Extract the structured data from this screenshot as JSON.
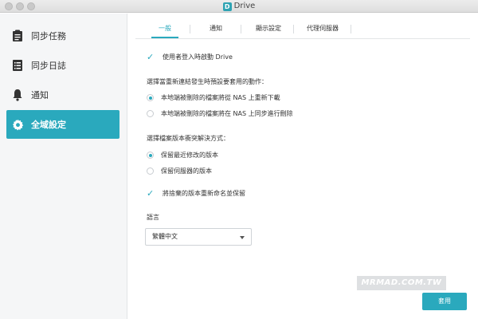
{
  "window": {
    "title": "Drive",
    "logo_letter": "D"
  },
  "sidebar": {
    "items": [
      {
        "label": "同步任務",
        "icon": "clipboard-icon"
      },
      {
        "label": "同步日誌",
        "icon": "log-icon"
      },
      {
        "label": "通知",
        "icon": "bell-icon"
      },
      {
        "label": "全域設定",
        "icon": "gear-icon",
        "active": true
      }
    ]
  },
  "tabs": [
    {
      "label": "一般",
      "active": true
    },
    {
      "label": "通知"
    },
    {
      "label": "顯示設定"
    },
    {
      "label": "代理伺服器"
    }
  ],
  "settings": {
    "launch_on_login": {
      "label": "使用者登入時啟動 Drive",
      "checked": true
    },
    "delete_action_title": "選擇當重新連結發生時預設要套用的動作：",
    "delete_options": [
      {
        "label": "本地端被刪除的檔案將從 NAS 上重新下載",
        "selected": true
      },
      {
        "label": "本地端被刪除的檔案將在 NAS 上同步進行刪除",
        "selected": false
      }
    ],
    "conflict_title": "選擇檔案版本衝突解決方式：",
    "conflict_options": [
      {
        "label": "保留最近修改的版本",
        "selected": true
      },
      {
        "label": "保留伺服器的版本",
        "selected": false
      }
    ],
    "rename_discarded": {
      "label": "將捨棄的版本重新命名並保留",
      "checked": true
    },
    "language_label": "語言",
    "language_value": "繁體中文"
  },
  "buttons": {
    "apply": "套用"
  },
  "watermark": "MRMAD.COM.TW",
  "colors": {
    "accent": "#2aa9bd",
    "sidebar_bg": "#f5f6f7"
  }
}
